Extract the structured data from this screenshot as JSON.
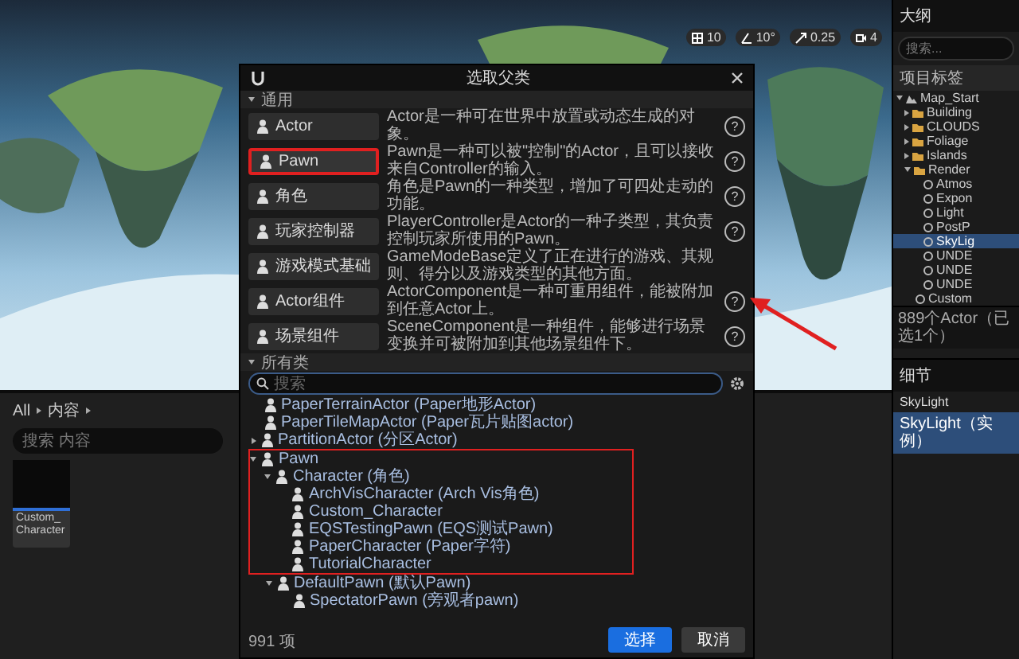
{
  "viewport": {
    "toolbar": [
      {
        "kind": "grid",
        "value": "10"
      },
      {
        "kind": "angle",
        "value": "10°"
      },
      {
        "kind": "scale",
        "value": "0.25"
      },
      {
        "kind": "camera",
        "value": "4"
      }
    ]
  },
  "dialog": {
    "title": "选取父类",
    "common": {
      "label": "通用",
      "expanded": true,
      "rows": [
        {
          "button": "Actor",
          "description": "Actor是一种可在世界中放置或动态生成的对象。",
          "help": "?",
          "highlighted": false
        },
        {
          "button": "Pawn",
          "description": "Pawn是一种可以被\"控制\"的Actor，且可以接收来自Controller的输入。",
          "help": "?",
          "highlighted": true
        },
        {
          "button": "角色",
          "description": "角色是Pawn的一种类型，增加了可四处走动的功能。",
          "help": "?",
          "highlighted": false
        },
        {
          "button": "玩家控制器",
          "description": "PlayerController是Actor的一种子类型，其负责控制玩家所使用的Pawn。",
          "help": "?",
          "highlighted": false
        },
        {
          "button": "游戏模式基础",
          "description": "GameModeBase定义了正在进行的游戏、其规则、得分以及游戏类型的其他方面。",
          "highlighted": false
        },
        {
          "button": "Actor组件",
          "description": "ActorComponent是一种可重用组件，能被附加到任意Actor上。",
          "help": "?",
          "highlighted": false
        },
        {
          "button": "场景组件",
          "description": "SceneComponent是一种组件，能够进行场景变换并可被附加到其他场景组件下。",
          "help": "?",
          "highlighted": false
        }
      ]
    },
    "all": {
      "label": "所有类",
      "expanded": true,
      "search": {
        "placeholder": "搜索"
      },
      "tree": [
        {
          "label": "PaperTerrainActor (Paper地形Actor)",
          "highlighted": false
        },
        {
          "label": "PaperTileMapActor (Paper瓦片贴图actor)",
          "highlighted": false
        },
        {
          "label": "PartitionActor (分区Actor)",
          "expanded": false,
          "highlighted": false
        },
        {
          "label": "Pawn",
          "expanded": true,
          "highlighted": true,
          "children": [
            {
              "label": "Character (角色)",
              "expanded": true,
              "highlighted": true,
              "children": [
                {
                  "label": "ArchVisCharacter (Arch Vis角色)",
                  "highlighted": true
                },
                {
                  "label": "Custom_Character",
                  "highlighted": true
                },
                {
                  "label": "EQSTestingPawn (EQS测试Pawn)",
                  "highlighted": true
                },
                {
                  "label": "PaperCharacter (Paper字符)",
                  "highlighted": true
                },
                {
                  "label": "TutorialCharacter",
                  "highlighted": true
                }
              ]
            },
            {
              "label": "DefaultPawn (默认Pawn)",
              "expanded": true,
              "highlighted": false,
              "children": [
                {
                  "label": "SpectatorPawn (旁观者pawn)",
                  "highlighted": false
                }
              ]
            }
          ]
        }
      ],
      "count": "991 项"
    },
    "buttons": [
      {
        "label": "选择",
        "kind": "primary"
      },
      {
        "label": "取消",
        "kind": "secondary"
      }
    ]
  },
  "outliner": {
    "title": "大纲",
    "search": {
      "placeholder": "搜索..."
    },
    "column": "项目标签",
    "items": [
      {
        "label": "Map_Start",
        "kind": "map",
        "expanded": true,
        "selected": false,
        "children": [
          {
            "label": "Building",
            "kind": "folder",
            "expanded": false,
            "selected": false
          },
          {
            "label": "CLOUDS",
            "kind": "folder",
            "expanded": false,
            "selected": false
          },
          {
            "label": "Foliage",
            "kind": "folder",
            "expanded": false,
            "selected": false
          },
          {
            "label": "Islands",
            "kind": "folder",
            "expanded": false,
            "selected": false
          },
          {
            "label": "Render",
            "kind": "folder",
            "expanded": true,
            "selected": false,
            "children": [
              {
                "label": "Atmos",
                "kind": "actor",
                "selected": false
              },
              {
                "label": "Expon",
                "kind": "actor",
                "selected": false
              },
              {
                "label": "Light",
                "kind": "actor",
                "selected": false
              },
              {
                "label": "PostP",
                "kind": "actor",
                "selected": false
              },
              {
                "label": "SkyLig",
                "kind": "actor",
                "selected": true
              },
              {
                "label": "UNDE",
                "kind": "actor",
                "selected": false
              },
              {
                "label": "UNDE",
                "kind": "actor",
                "selected": false
              },
              {
                "label": "UNDE",
                "kind": "actor",
                "selected": false
              }
            ]
          },
          {
            "label": "Custom",
            "kind": "actor",
            "selected": false
          }
        ]
      }
    ],
    "footer": "889个Actor（已选1个）"
  },
  "details": {
    "title": "细节",
    "object": "SkyLight",
    "component": "SkyLight（实例）"
  },
  "content_browser": {
    "breadcrumb": [
      "All",
      "内容"
    ],
    "search": {
      "placeholder": "搜索 内容"
    },
    "assets": [
      {
        "label": "Custom_Character"
      }
    ]
  }
}
